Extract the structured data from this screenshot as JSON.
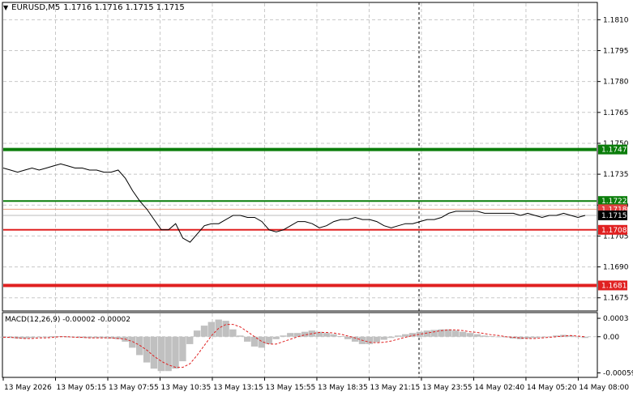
{
  "header": {
    "menu_icon": "triangle-down-icon",
    "symbol_tf": "EURUSD,M5",
    "ohlc": "1.1716 1.1716 1.1715 1.1715"
  },
  "price_axis": {
    "ticks": [
      "1.1810",
      "1.1795",
      "1.1780",
      "1.1765",
      "1.1750",
      "1.1735",
      "1.1720",
      "1.1705",
      "1.1690",
      "1.1675"
    ]
  },
  "levels": [
    {
      "label": "1.1747",
      "value": 1.1747,
      "color": "#0a7d0a",
      "bg": "#0a7d0a"
    },
    {
      "label": "1.1722",
      "value": 1.1722,
      "color": "#0a7d0a",
      "bg": "#0a7d0a"
    },
    {
      "label": "1.1718",
      "value": 1.1718,
      "color": "#e04040",
      "bg": "#e04040"
    },
    {
      "label": "1.1715",
      "value": 1.1715,
      "color": "#000000",
      "bg": "#000000"
    },
    {
      "label": "1.1708",
      "value": 1.1708,
      "color": "#e02020",
      "bg": "#e02020"
    },
    {
      "label": "1.1681",
      "value": 1.1681,
      "color": "#e02020",
      "bg": "#e02020"
    }
  ],
  "macd": {
    "header": "MACD(12,26,9) -0.00002 -0.00002",
    "ticks": [
      "0.0003",
      "0.00",
      "-0.00059"
    ]
  },
  "time_axis": {
    "labels": [
      "13 May 2026",
      "13 May 05:15",
      "13 May 07:55",
      "13 May 10:35",
      "13 May 13:15",
      "13 May 15:55",
      "13 May 18:35",
      "13 May 21:15",
      "13 May 23:55",
      "14 May 02:40",
      "14 May 05:20",
      "14 May 08:00"
    ]
  },
  "chart_data": {
    "type": "line",
    "title": "EURUSD,M5",
    "price": [
      1.1738,
      1.1737,
      1.1736,
      1.1737,
      1.1738,
      1.1737,
      1.1738,
      1.1739,
      1.174,
      1.1739,
      1.1738,
      1.1738,
      1.1737,
      1.1737,
      1.1736,
      1.1736,
      1.1737,
      1.1733,
      1.1727,
      1.1722,
      1.1718,
      1.1713,
      1.1708,
      1.1708,
      1.1711,
      1.1704,
      1.1702,
      1.1706,
      1.171,
      1.1711,
      1.1711,
      1.1713,
      1.1715,
      1.1715,
      1.1714,
      1.1714,
      1.1712,
      1.1708,
      1.1707,
      1.1708,
      1.171,
      1.1712,
      1.1712,
      1.1711,
      1.1709,
      1.171,
      1.1712,
      1.1713,
      1.1713,
      1.1714,
      1.1713,
      1.1713,
      1.1712,
      1.171,
      1.1709,
      1.171,
      1.1711,
      1.1711,
      1.1712,
      1.1713,
      1.1713,
      1.1714,
      1.1716,
      1.1717,
      1.1717,
      1.1717,
      1.1717,
      1.1716,
      1.1716,
      1.1716,
      1.1716,
      1.1716,
      1.1715,
      1.1716,
      1.1715,
      1.1714,
      1.1715,
      1.1715,
      1.1716,
      1.1715,
      1.1714,
      1.1715
    ],
    "ylim": [
      1.1669,
      1.1818
    ],
    "macd_hist": [
      -1e-05,
      -2e-05,
      -3e-05,
      -3e-05,
      -2e-05,
      -1e-05,
      -1e-05,
      1e-05,
      1e-05,
      -1e-05,
      -1e-05,
      -2e-05,
      -2e-05,
      -2e-05,
      -2e-05,
      -3e-05,
      -4e-05,
      -8e-05,
      -0.00018,
      -0.0003,
      -0.00042,
      -0.00052,
      -0.00056,
      -0.00056,
      -0.00052,
      -0.0004,
      -0.00012,
      0.0001,
      0.00018,
      0.00024,
      0.00028,
      0.00026,
      0.00012,
      2e-05,
      -8e-05,
      -0.00016,
      -0.00018,
      -0.00012,
      -4e-05,
      2e-05,
      6e-05,
      6e-05,
      8e-05,
      0.0001,
      8e-05,
      6e-05,
      4e-05,
      1e-05,
      -4e-05,
      -8e-05,
      -0.00012,
      -0.00012,
      -9e-05,
      -5e-05,
      -2e-05,
      2e-05,
      4e-05,
      6e-05,
      8e-05,
      0.0001,
      0.00011,
      0.00012,
      0.00012,
      0.0001,
      8e-05,
      6e-05,
      4e-05,
      2e-05,
      1e-05,
      0.0,
      -1e-05,
      -3e-05,
      -4e-05,
      -3e-05,
      -2e-05,
      -1e-05,
      0.0,
      2e-05,
      3e-05,
      2e-05,
      0.0,
      -2e-05
    ],
    "macd_signal": [
      -1e-05,
      -1e-05,
      -2e-05,
      -3e-05,
      -3e-05,
      -2e-05,
      -2e-05,
      -1e-05,
      0.0,
      0.0,
      -1e-05,
      -1e-05,
      -2e-05,
      -2e-05,
      -2e-05,
      -2e-05,
      -3e-05,
      -4e-05,
      -8e-05,
      -0.00014,
      -0.00022,
      -0.00032,
      -0.0004,
      -0.00046,
      -0.0005,
      -0.0005,
      -0.00044,
      -0.0003,
      -0.00014,
      2e-05,
      0.00014,
      0.0002,
      0.0002,
      0.00016,
      8e-05,
      0.0,
      -8e-05,
      -0.00012,
      -0.00012,
      -8e-05,
      -4e-05,
      0.0,
      3e-05,
      5e-05,
      7e-05,
      7e-05,
      6e-05,
      4e-05,
      1e-05,
      -2e-05,
      -6e-05,
      -9e-05,
      -0.0001,
      -9e-05,
      -7e-05,
      -4e-05,
      -1e-05,
      2e-05,
      4e-05,
      6e-05,
      8e-05,
      0.0001,
      0.00011,
      0.00011,
      0.0001,
      8e-05,
      7e-05,
      5e-05,
      3e-05,
      2e-05,
      0.0,
      -1e-05,
      -2e-05,
      -3e-05,
      -3e-05,
      -2e-05,
      -1e-05,
      0.0,
      1e-05,
      2e-05,
      1e-05,
      0.0
    ],
    "macd_ylim": [
      -0.00065,
      0.00038
    ]
  }
}
